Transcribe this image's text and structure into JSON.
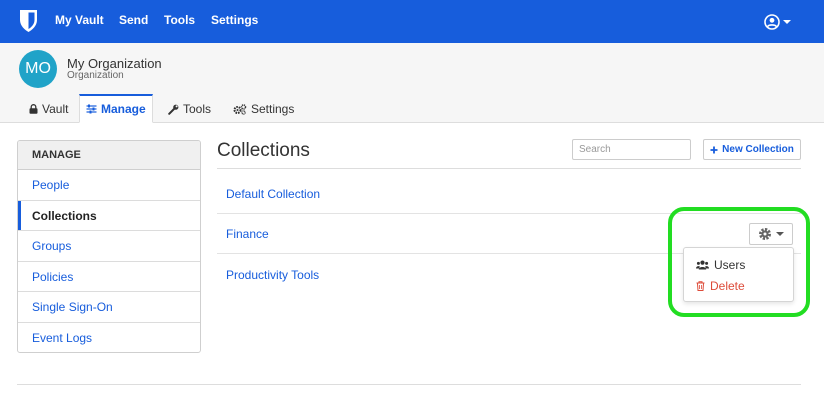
{
  "navbar": {
    "brand_icon": "bitwarden-shield-icon",
    "links": [
      "My Vault",
      "Send",
      "Tools",
      "Settings"
    ],
    "account_icon": "user-circle-icon",
    "background": "#175ddc"
  },
  "org": {
    "avatar_initials": "MO",
    "avatar_color": "#20a3c8",
    "name": "My Organization",
    "subtitle": "Organization"
  },
  "tabs": [
    {
      "label": "Vault",
      "icon": "lock-icon",
      "active": false
    },
    {
      "label": "Manage",
      "icon": "sliders-icon",
      "active": true
    },
    {
      "label": "Tools",
      "icon": "wrench-icon",
      "active": false
    },
    {
      "label": "Settings",
      "icon": "cogs-icon",
      "active": false
    }
  ],
  "sidebar": {
    "heading": "MANAGE",
    "items": [
      {
        "label": "People",
        "active": false
      },
      {
        "label": "Collections",
        "active": true
      },
      {
        "label": "Groups",
        "active": false
      },
      {
        "label": "Policies",
        "active": false
      },
      {
        "label": "Single Sign-On",
        "active": false
      },
      {
        "label": "Event Logs",
        "active": false
      }
    ]
  },
  "main": {
    "title": "Collections",
    "search_placeholder": "Search",
    "new_button_label": "New Collection",
    "collections": [
      "Default Collection",
      "Finance",
      "Productivity Tools"
    ]
  },
  "row_menu": {
    "button_icon": "gear-icon",
    "items": [
      {
        "label": "Users",
        "icon": "users-icon",
        "color": "#333333"
      },
      {
        "label": "Delete",
        "icon": "trash-icon",
        "color": "#dd4b39"
      }
    ]
  },
  "highlight_color": "#22dd22"
}
